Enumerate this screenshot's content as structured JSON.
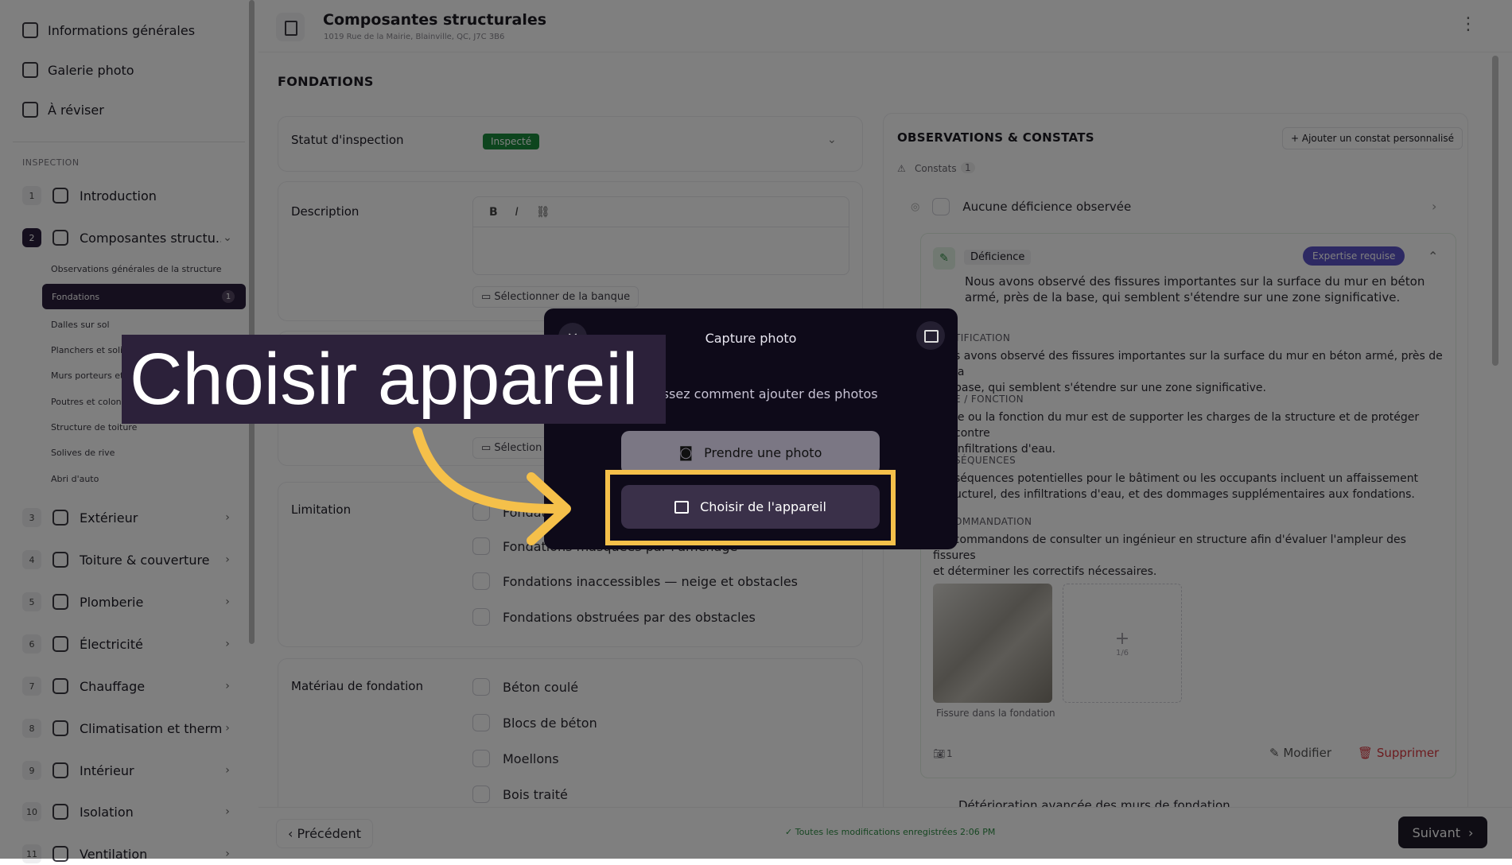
{
  "sidebar": {
    "top": [
      {
        "label": "Informations générales",
        "icon": "document-icon"
      },
      {
        "label": "Galerie photo",
        "icon": "gallery-icon"
      },
      {
        "label": "À réviser",
        "icon": "review-icon"
      }
    ],
    "section_label": "INSPECTION",
    "items": [
      {
        "num": "1",
        "label": "Introduction"
      },
      {
        "num": "2",
        "label": "Composantes structu..."
      },
      {
        "num": "3",
        "label": "Extérieur"
      },
      {
        "num": "4",
        "label": "Toiture & couverture"
      },
      {
        "num": "5",
        "label": "Plomberie"
      },
      {
        "num": "6",
        "label": "Électricité"
      },
      {
        "num": "7",
        "label": "Chauffage"
      },
      {
        "num": "8",
        "label": "Climatisation et therm..."
      },
      {
        "num": "9",
        "label": "Intérieur"
      },
      {
        "num": "10",
        "label": "Isolation"
      },
      {
        "num": "11",
        "label": "Ventilation"
      }
    ],
    "subitems": [
      "Observations générales de la structure",
      "Fondations",
      "Dalles sur sol",
      "Planchers et soli",
      "Murs porteurs et",
      "Poutres et colon",
      "Structure de toiture",
      "Solives de rive",
      "Abri d'auto"
    ],
    "active_sub_count": "1"
  },
  "header": {
    "title": "Composantes structurales",
    "address": "1019 Rue de la Mairie, Blainville, QC, J7C 3B6"
  },
  "main": {
    "section_title": "FONDATIONS",
    "status_label": "Statut d'inspection",
    "status_value": "Inspecté",
    "description_label": "Description",
    "bank_button": "Sélectionner de la banque",
    "bank_button_short": "Sélection",
    "limitation_label": "Limitation",
    "limitations": [
      "Fondations masquées par finitions",
      "Fondations inaccessibles — neige et obstacles",
      "Fondations obstruées par des obstacles"
    ],
    "limitation_partial": "Fondations masquées par l'aménage",
    "material_label": "Matériau de fondation",
    "materials": [
      "Béton coulé",
      "Blocs de béton",
      "Moellons",
      "Bois traité"
    ]
  },
  "observations": {
    "title": "OBSERVATIONS & CONSTATS",
    "add_button": "+ Ajouter un constat personnalisé",
    "constats_label": "Constats",
    "constats_count": "1",
    "no_def": "Aucune déficience observée",
    "def_tag": "Déficience",
    "expertise": "Expertise requise",
    "summary": "Nous avons observé des fissures importantes sur la surface du mur en béton armé, près de la base, qui semblent s'étendre sur une zone significative.",
    "sections": [
      {
        "cap": "TIFICATION",
        "text": "s avons observé des fissures importantes sur la surface du mur en béton armé, près de la\nbase, qui semblent s'étendre sur une zone significative."
      },
      {
        "cap": "E / FONCTION",
        "text": "le ou la fonction du mur est de supporter les charges de la structure et de protéger contre\ninfiltrations d'eau."
      },
      {
        "cap": "SÉQUENCES",
        "text": "séquences potentielles pour le bâtiment ou les occupants incluent un affaissement\nucturel, des infiltrations d'eau, et des dommages supplémentaires aux fondations."
      },
      {
        "cap": "OMMANDATION",
        "text": "s recommandons de consulter un ingénieur en structure afin d'évaluer l'ampleur des fissures\net déterminer les correctifs nécessaires."
      }
    ],
    "photo_caption": "Fissure dans la fondation",
    "photo_slots": "1/6",
    "photo_count": "1",
    "edit": "Modifier",
    "delete": "Supprimer",
    "next_item": "Détérioration avancée des murs de fondation"
  },
  "footer": {
    "prev": "Précédent",
    "saved": "Toutes les modifications enregistrées 2:06 PM",
    "next": "Suivant"
  },
  "modal": {
    "title": "Capture photo",
    "subtitle": "Choisissez comment ajouter des photos",
    "take": "Prendre une photo",
    "choose": "Choisir de l'appareil"
  },
  "callout": {
    "text": "Choisir appareil"
  },
  "colors": {
    "accent": "#2a1e3d",
    "highlight": "#f5c04a",
    "status": "#1a8a3c",
    "expertise": "#5b53c6",
    "danger": "#d9363e"
  }
}
